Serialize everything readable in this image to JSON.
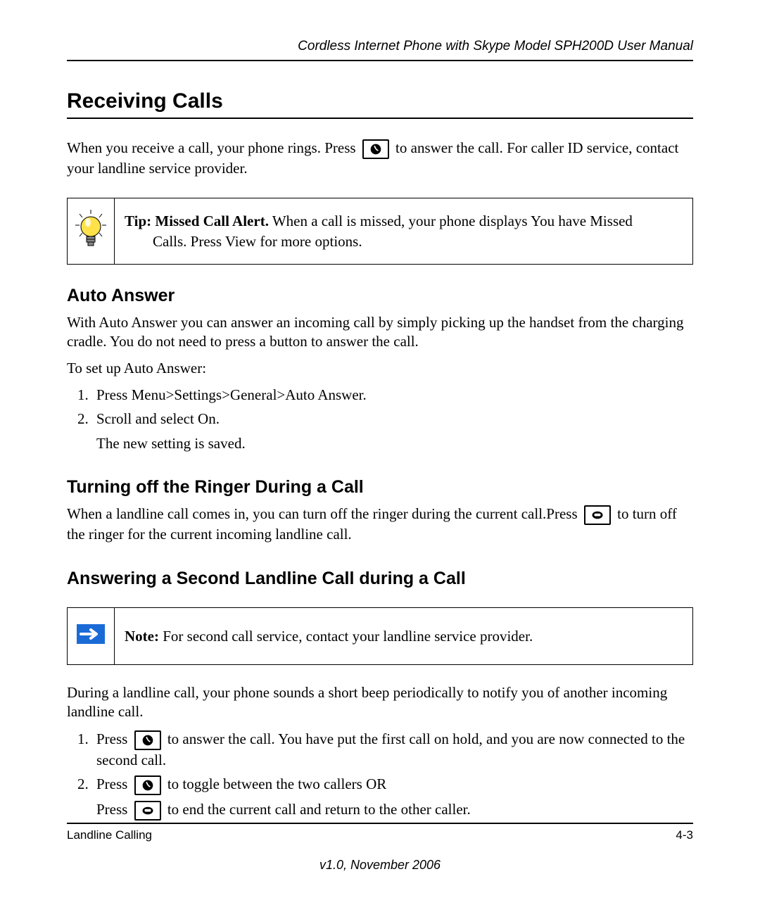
{
  "header": {
    "running_title": "Cordless Internet Phone with Skype Model SPH200D User Manual"
  },
  "main": {
    "h1": "Receiving Calls",
    "intro_before_icon": "When you receive a call, your phone rings. Press ",
    "intro_after_icon": " to answer the call. For caller ID service, contact your landline service provider.",
    "tip": {
      "bold": "Tip: Missed Call Alert.",
      "line1": " When a call is missed, your phone displays You have Missed",
      "line2": "Calls. Press View for more options."
    },
    "auto_answer": {
      "title": "Auto Answer",
      "p1": "With Auto Answer you can answer an incoming call by simply picking up the handset from the charging cradle. You do not need to press a button to answer the call.",
      "p2": "To set up Auto Answer:",
      "steps": [
        "Press Menu>Settings>General>Auto Answer.",
        "Scroll and select On."
      ],
      "result": "The new setting is saved."
    },
    "ringer_off": {
      "title": "Turning off the Ringer During a Call",
      "p_before_icon": "When a landline call comes in, you can turn off the ringer during the current call.Press ",
      "p_after_icon": " to turn off the ringer for the current incoming landline call."
    },
    "second_call": {
      "title": "Answering a Second Landline Call during a Call",
      "note_bold": "Note:",
      "note_rest": " For second call service, contact your landline service provider.",
      "p1": "During a landline call, your phone sounds a short beep periodically to notify you of another incoming landline call.",
      "step1_before": "Press ",
      "step1_after": " to answer the call. You have put the first call on hold, and you are now connected to the second call.",
      "step2_before": "Press ",
      "step2_after": " to toggle between the two callers OR",
      "step2b_before": "Press ",
      "step2b_after": " to end the current call and return to the other caller."
    }
  },
  "footer": {
    "section": "Landline Calling",
    "page": "4-3",
    "version": "v1.0, November 2006"
  }
}
